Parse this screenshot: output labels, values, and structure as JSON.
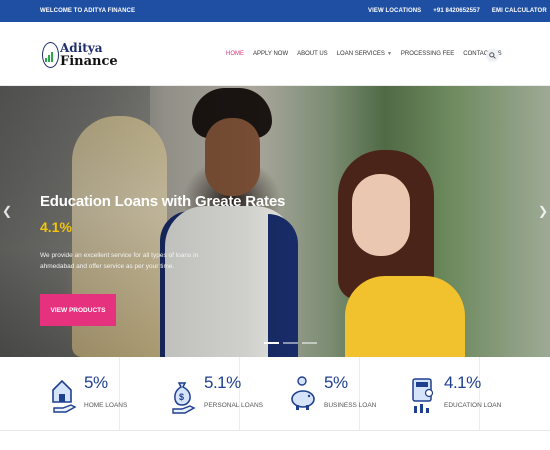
{
  "topbar": {
    "welcome_prefix": "WELCOME TO",
    "welcome_brand": "ADITYA FINANCE",
    "links": [
      "VIEW LOCATIONS",
      "+91 8420652557",
      "EMI CALCULATOR"
    ]
  },
  "logo": {
    "line1": "Aditya",
    "line2": "Finance"
  },
  "menu": {
    "items": [
      "HOME",
      "APPLY NOW",
      "ABOUT US",
      "LOAN SERVICES",
      "PROCESSING FEE",
      "CONTACT US"
    ],
    "active": "HOME"
  },
  "hero": {
    "title": "Education Loans with Greate Rates",
    "rate": "4.1%",
    "description": "We provide an excellent service for all types of loans in ahmedabad and offer service as per your time.",
    "cta": "VIEW PRODUCTS",
    "slides": 3,
    "active_slide": 1
  },
  "features": [
    {
      "percent": "5%",
      "label": "HOME LOANS",
      "icon": "house-hand-icon"
    },
    {
      "percent": "5.1%",
      "label": "PERSONAL LOANS",
      "icon": "money-bag-hand-icon"
    },
    {
      "percent": "5%",
      "label": "BUSINESS LOAN",
      "icon": "piggy-bank-icon"
    },
    {
      "percent": "4.1%",
      "label": "EDUCATION LOAN",
      "icon": "calculator-coins-icon"
    }
  ],
  "colors": {
    "topbar": "#1f4fa3",
    "accent": "#e6317f",
    "rate": "#f1c40f",
    "icon": "#1f3f8f"
  }
}
